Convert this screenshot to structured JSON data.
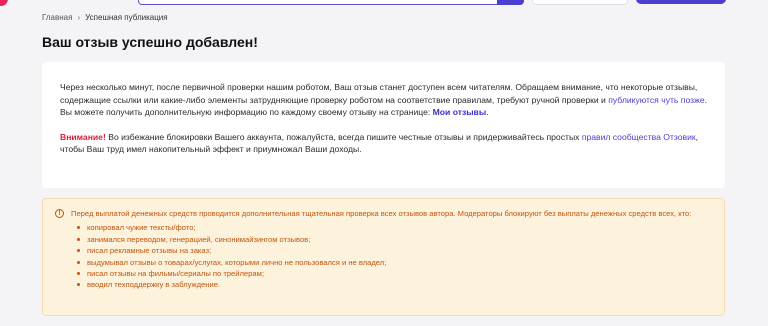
{
  "breadcrumb": {
    "home": "Главная",
    "separator": "›",
    "current": "Успешная публикация"
  },
  "page_title": "Ваш отзыв успешно добавлен!",
  "info_card": {
    "p1_text_a": "Через несколько минут, после первичной проверки нашим роботом, Ваш отзыв станет доступен всем читателям. Обращаем внимание, что некоторые отзывы, содержащие ссылки или какие-либо элементы затрудняющие проверку роботом на соответствие правилам, требуют ручной проверки и ",
    "p1_link": "публикуются чуть позже",
    "p1_text_b": ". Вы можете получить дополнительную информацию по каждому своему отзыву на странице: ",
    "p1_link_bold": "Мои отзывы",
    "p1_end": ".",
    "warn_label": "Внимание!",
    "p2_text_a": " Во избежание блокировки Вашего аккаунта, пожалуйста, всегда пишите честные отзывы и придерживайтесь простых ",
    "p2_link": "правил сообщества Отзовик",
    "p2_text_b": ", чтобы Ваш труд имел накопительный эффект и приумножал Ваши доходы."
  },
  "notice": {
    "icon": "info-circle-icon",
    "icon_glyph": "!",
    "intro": "Перед выплатой денежных средств проводится дополнительная тщательная проверка всех отзывов автора. Модераторы блокируют без выплаты денежных средств всех, кто:",
    "items": [
      "копировал чужие тексты/фото;",
      "занимался переводом, генерацией, синонимайзингом отзывов;",
      "писал рекламные отзывы на заказ;",
      "выдумывал отзывы о товарах/услугах, которыми лично не пользовался и не владел;",
      "писал отзывы на фильмы/сериалы по трейлерам;",
      "вводил техподдержку в заблуждение."
    ]
  },
  "colors": {
    "brand": "#e8235a",
    "accent": "#4b3fd0",
    "warning": "#d6213c",
    "notice_bg": "#fdf2dc",
    "notice_text": "#c2550e"
  }
}
